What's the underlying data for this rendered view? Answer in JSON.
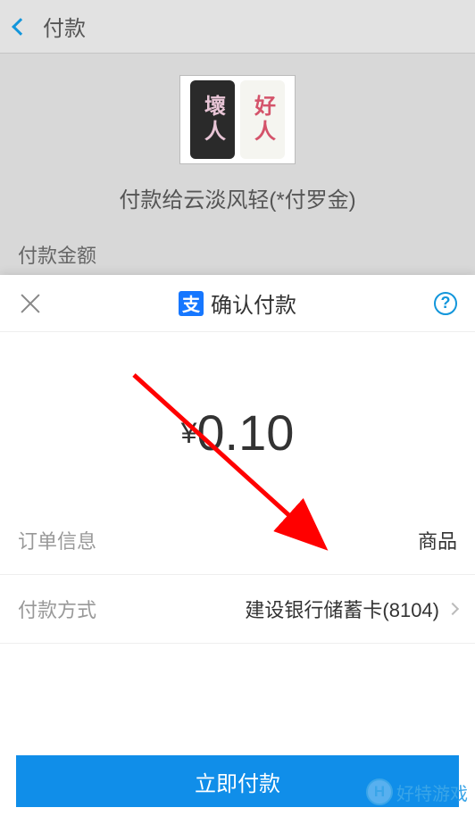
{
  "header": {
    "title": "付款"
  },
  "merchant": {
    "avatar_left": "壞人",
    "avatar_right": "好人",
    "pay_to": "付款给云淡风轻(*付罗金)"
  },
  "bg_label": "付款金额",
  "modal": {
    "logo_text": "支",
    "title": "确认付款",
    "help": "?",
    "currency": "¥",
    "amount": "0.10",
    "order_label": "订单信息",
    "order_value": "商品",
    "method_label": "付款方式",
    "method_value": "建设银行储蓄卡(8104)",
    "pay_button": "立即付款"
  },
  "watermark": {
    "logo": "H",
    "text": "好特游戏"
  }
}
